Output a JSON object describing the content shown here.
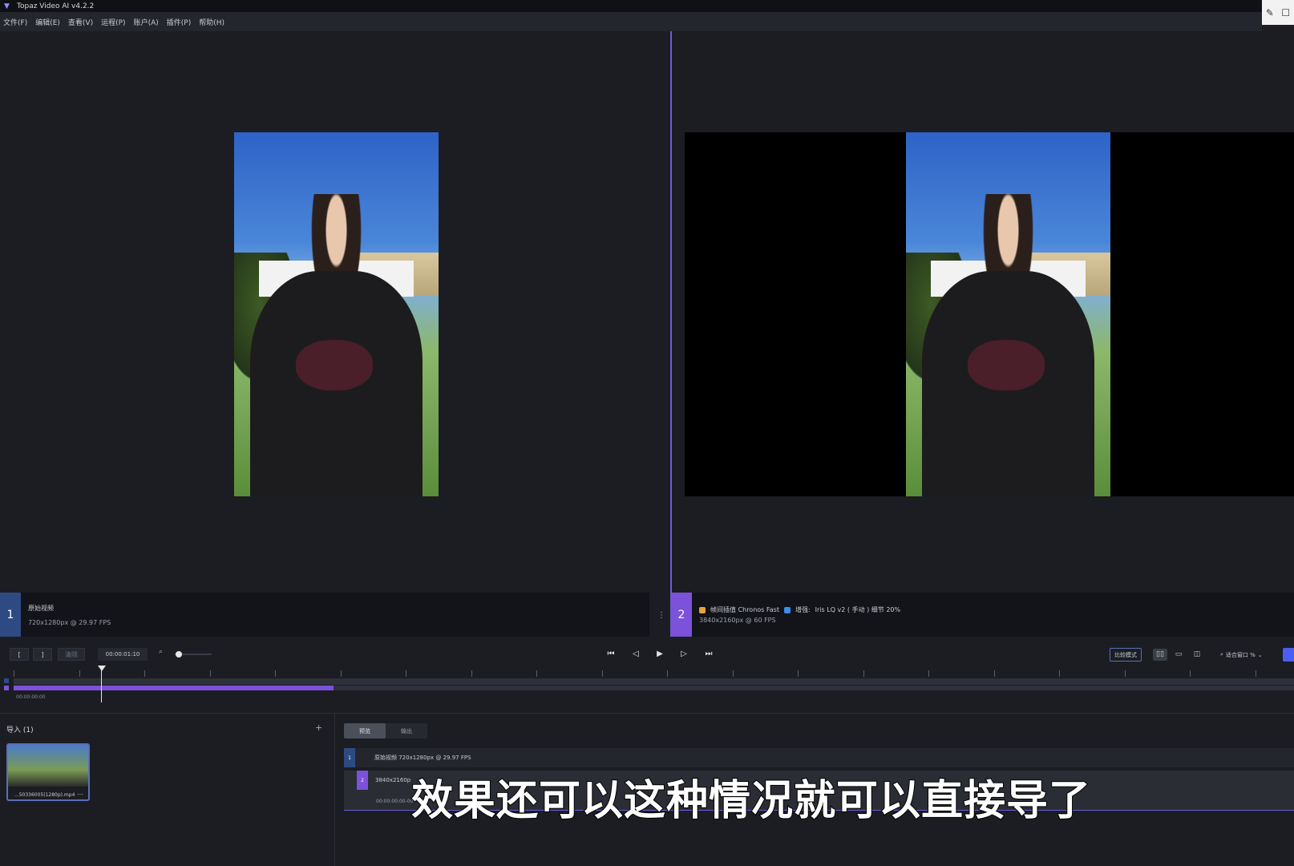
{
  "app": {
    "title": "Topaz Video AI  v4.2.2",
    "logo_icon": "topaz-logo-icon"
  },
  "menu": [
    "文件(F)",
    "编辑(E)",
    "查看(V)",
    "运程(P)",
    "账户(A)",
    "插件(P)",
    "帮助(H)"
  ],
  "window_controls": [
    "edit-icon",
    "maximize-icon"
  ],
  "viewer_left": {
    "index": "1",
    "name": "原始视频",
    "spec": "720x1280px @ 29.97 FPS"
  },
  "viewer_right": {
    "index": "2",
    "interp_label": "帧间插值 Chronos Fast",
    "enhance_label": "增强:",
    "model_label": "Iris LQ v2 ( 手动 ) 细节 20%",
    "spec": "3840x2160px @ 60 FPS"
  },
  "controls": {
    "in_mark": "[",
    "out_mark": "]",
    "clear_label": "清除",
    "timecode": "00:00:01:10",
    "compare_label": "比较模式",
    "fit_label": "适合窗口 %",
    "zoom_value": 0.05
  },
  "timeline": {
    "start_time": "00:00:00:00",
    "progress": 0.25,
    "playhead": 0.07
  },
  "import_panel": {
    "title": "导入 (1)",
    "add_icon": "plus-icon",
    "file_name": "...50336005(1280p).mp4"
  },
  "export_panel": {
    "tabs": [
      "预览",
      "输出"
    ],
    "active_tab": 0,
    "rows": [
      {
        "index": "1",
        "text": "原始视频    720x1280px @ 29.97 FPS"
      },
      {
        "index": "2",
        "text": "3840x2160p",
        "sub": "00:00:00:00-00"
      }
    ]
  },
  "subtitle": "效果还可以这种情况就可以直接导了",
  "colors": {
    "accent_purple": "#7b52d9",
    "accent_blue": "#2d4a83",
    "background": "#1b1d23"
  }
}
